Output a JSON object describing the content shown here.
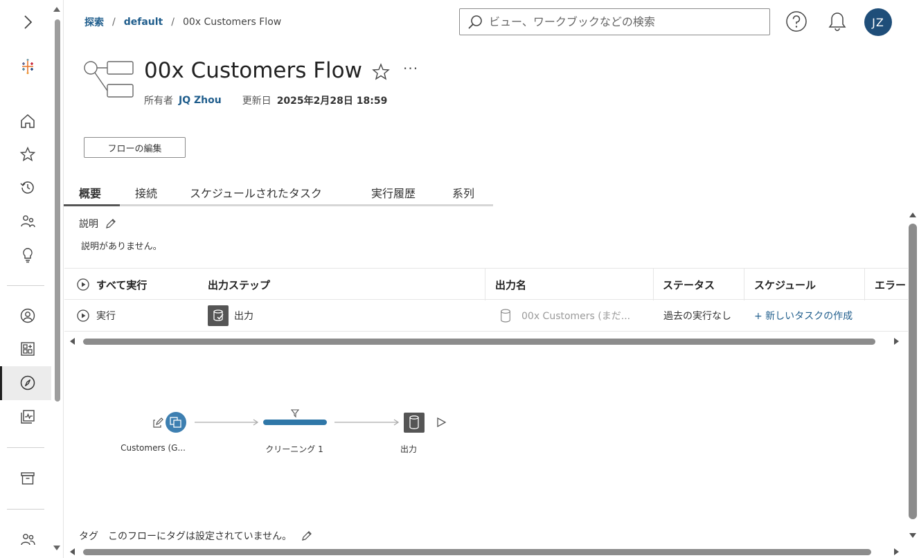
{
  "breadcrumb": {
    "root": "探索",
    "project": "default",
    "current": "00x Customers Flow"
  },
  "search": {
    "placeholder": "ビュー、ワークブックなどの検索"
  },
  "user": {
    "initials": "JZ"
  },
  "title": "00x Customers Flow",
  "meta": {
    "owner_label": "所有者",
    "owner": "JQ Zhou",
    "updated_label": "更新日",
    "updated": "2025年2月28日 18:59"
  },
  "edit_flow_label": "フローの編集",
  "tabs": [
    {
      "label": "概要"
    },
    {
      "label": "接続"
    },
    {
      "label": "スケジュールされたタスク"
    },
    {
      "label": "実行履歴"
    },
    {
      "label": "系列"
    }
  ],
  "description": {
    "label": "説明",
    "text": "説明がありません。"
  },
  "table": {
    "headers": {
      "run_all": "すべて実行",
      "output_step": "出力ステップ",
      "output_name": "出力名",
      "status": "ステータス",
      "schedule": "スケジュール",
      "error": "エラー"
    },
    "rows": [
      {
        "run": "実行",
        "output_step": "出力",
        "output_name": "00x Customers (まだ...",
        "status": "過去の実行なし",
        "schedule": "+ 新しいタスクの作成"
      }
    ]
  },
  "flow": {
    "nodes": [
      {
        "label": "Customers (G..."
      },
      {
        "label": "クリーニング 1"
      },
      {
        "label": "出力"
      }
    ]
  },
  "tags": {
    "label": "タグ",
    "text": "このフローにタグは設定されていません。"
  },
  "colors": {
    "accent": "#1f5d8c",
    "avatar": "#1f4e79",
    "flow_node": "#3d7fb1",
    "clean_bar": "#2f77a8"
  }
}
